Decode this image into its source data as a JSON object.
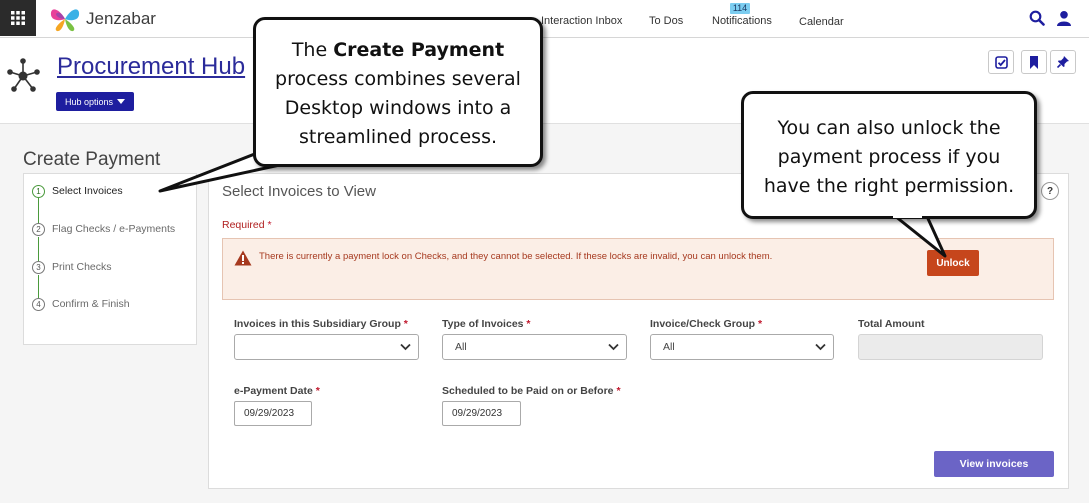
{
  "topbar": {
    "brand": "Jenzabar",
    "nav": [
      "Interaction Inbox",
      "To Dos",
      "Notifications",
      "Calendar"
    ],
    "notifications_count": "114",
    "icons": [
      "apps-grid-icon",
      "search-icon",
      "user-icon"
    ]
  },
  "hub": {
    "title": "Procurement Hub",
    "options_label": "Hub options",
    "action_icons": [
      "checklist-icon",
      "bookmark-icon",
      "pin-icon"
    ]
  },
  "page": {
    "title": "Create Payment",
    "steps": [
      {
        "number": "1",
        "label": "Select Invoices",
        "active": true
      },
      {
        "number": "2",
        "label": "Flag Checks / e-Payments",
        "active": false
      },
      {
        "number": "3",
        "label": "Print Checks",
        "active": false
      },
      {
        "number": "4",
        "label": "Confirm & Finish",
        "active": false
      }
    ]
  },
  "panel": {
    "title": "Select Invoices to View",
    "help": "?",
    "required_label": "Required",
    "required_star": "*",
    "alert_text": "There is currently a payment lock on Checks, and they cannot be selected. If these locks are invalid, you can unlock them.",
    "unlock_label": "Unlock",
    "fields": {
      "subsidiary_group": {
        "label": "Invoices in this Subsidiary Group",
        "value": ""
      },
      "type_of_invoices": {
        "label": "Type of Invoices",
        "value": "All"
      },
      "invoice_check_group": {
        "label": "Invoice/Check Group",
        "value": "All"
      },
      "total_amount": {
        "label": "Total Amount",
        "value": ""
      },
      "epayment_date": {
        "label": "e-Payment Date",
        "value": "09/29/2023"
      },
      "scheduled_date": {
        "label": "Scheduled to be Paid on or Before",
        "value": "09/29/2023"
      }
    },
    "view_invoices_label": "View invoices"
  },
  "callouts": {
    "create_payment": {
      "line1_pre": "The ",
      "line1_bold": "Create Payment",
      "rest": "process combines several Desktop windows into a streamlined process."
    },
    "unlock": {
      "text": "You can also unlock the payment process if you have the right permission."
    }
  },
  "colors": {
    "brand_navy": "#1e1e9f",
    "unlock_orange": "#c6461c",
    "primary_button": "#6b64c6",
    "alert_bg": "#fbeee6",
    "required_red": "#b01e1e",
    "step_active_green": "#4a9a3c"
  }
}
